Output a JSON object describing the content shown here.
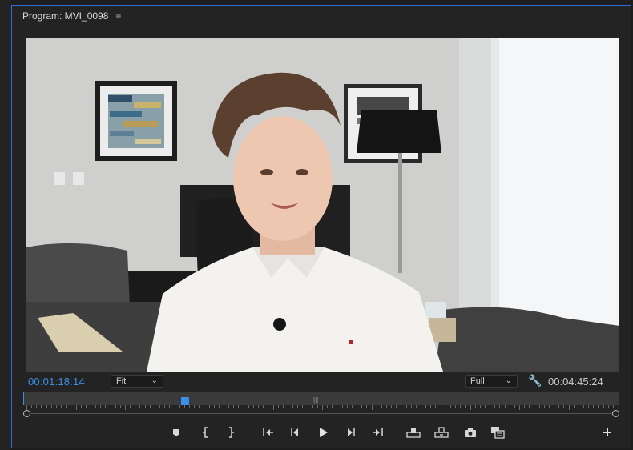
{
  "panel": {
    "title": "Program: MVI_0098",
    "menu_icon": "hamburger-menu-icon"
  },
  "playback": {
    "current_timecode": "00:01:18:14",
    "duration_timecode": "00:04:45:24",
    "zoom_value": "Fit",
    "quality_value": "Full",
    "playhead_position": 0.27
  },
  "colors": {
    "accent": "#3b8eea",
    "panel_bg": "#232323",
    "panel_border": "#2f6fd6"
  },
  "transport_icons": [
    "add-marker-icon",
    "mark-in-icon",
    "mark-out-icon",
    "go-to-in-icon",
    "step-back-icon",
    "play-icon",
    "step-forward-icon",
    "go-to-out-icon",
    "lift-icon",
    "extract-icon",
    "export-frame-icon",
    "comparison-view-icon",
    "button-editor-plus-icon"
  ]
}
